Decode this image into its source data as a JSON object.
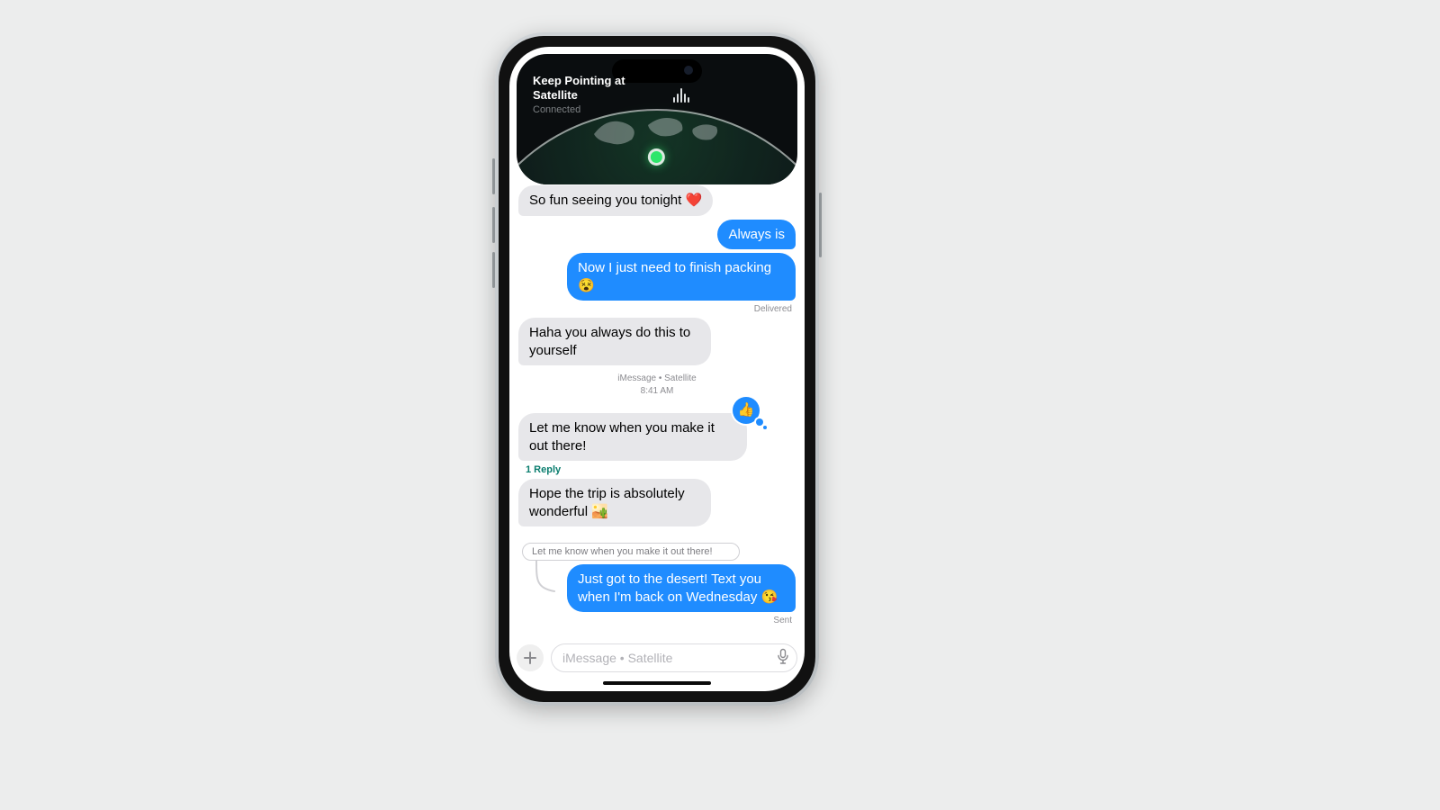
{
  "colors": {
    "outgoing": "#1f8cff",
    "incoming": "#e7e7ea",
    "replyLink": "#0a7d6e"
  },
  "satellite": {
    "title": "Keep Pointing at Satellite",
    "status": "Connected"
  },
  "divider": {
    "line1": "iMessage • Satellite",
    "line2": "8:41 AM"
  },
  "messages": {
    "m0": {
      "text": "So fun seeing you tonight ❤️"
    },
    "m1": {
      "text": "Always is"
    },
    "m2": {
      "text": "Now I just need to finish packing 😵"
    },
    "m2_status": "Delivered",
    "m3": {
      "text": "Haha you always do this to yourself"
    },
    "m4": {
      "text": "Let me know when you make it out there!",
      "reaction": "👍",
      "replies": "1 Reply"
    },
    "m5": {
      "text": "Hope the trip is absolutely wonderful 🏜️"
    },
    "quote": "Let me know when you make it out there!",
    "m6": {
      "text": "Just got to the desert! Text you when I'm back on Wednesday 😘"
    },
    "m6_status": "Sent"
  },
  "compose": {
    "placeholder": "iMessage • Satellite"
  }
}
